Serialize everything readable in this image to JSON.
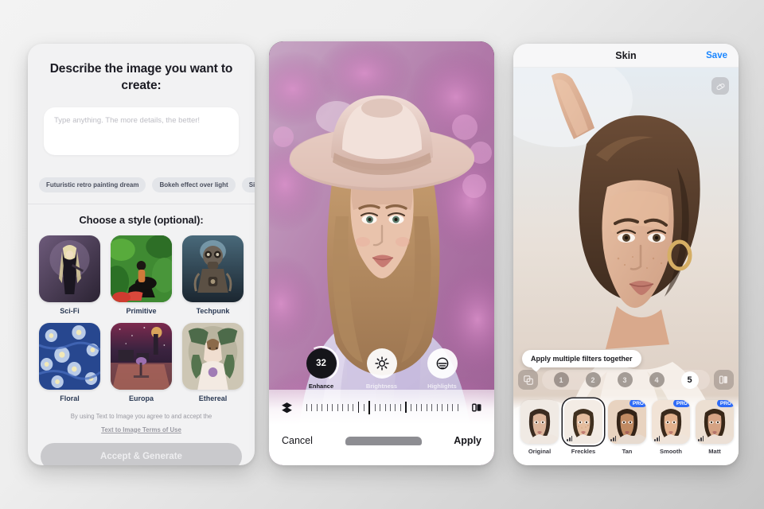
{
  "describe_panel": {
    "title": "Describe the image you want to create:",
    "prompt_input": {
      "value": "",
      "placeholder": "Type anything. The more details, the better!"
    },
    "suggestion_chips": [
      "Futuristic retro painting dream",
      "Bokeh effect over light",
      "Si"
    ],
    "style_section_title": "Choose a style (optional):",
    "styles": [
      {
        "label": "Sci-Fi"
      },
      {
        "label": "Primitive"
      },
      {
        "label": "Techpunk"
      },
      {
        "label": "Floral"
      },
      {
        "label": "Europa"
      },
      {
        "label": "Ethereal"
      }
    ],
    "terms_text": "By using Text to Image you agree to and accept the",
    "terms_link": "Text to Image Terms of Use",
    "cta_label": "Accept & Generate"
  },
  "editor_panel": {
    "tools": [
      {
        "label": "Enhance",
        "value": "32",
        "state": "active"
      },
      {
        "label": "Brightness",
        "value": "",
        "state": "inactive"
      },
      {
        "label": "Highlights",
        "value": "",
        "state": "inactive"
      }
    ],
    "layers_icon": "layers-icon",
    "compare_icon": "compare-icon",
    "cancel_label": "Cancel",
    "apply_label": "Apply"
  },
  "skin_panel": {
    "title": "Skin",
    "save_label": "Save",
    "eraser_icon": "eraser-icon",
    "tooltip": "Apply multiple filters together",
    "stack_icon": "stack-icon",
    "compare_icon": "compare-icon",
    "intensity_steps": [
      "1",
      "2",
      "3",
      "4",
      "5"
    ],
    "intensity_selected": "5",
    "filters": [
      {
        "label": "Original",
        "pro": false,
        "selected": false
      },
      {
        "label": "Freckles",
        "pro": false,
        "selected": true
      },
      {
        "label": "Tan",
        "pro": true,
        "selected": false
      },
      {
        "label": "Smooth",
        "pro": true,
        "selected": false
      },
      {
        "label": "Matt",
        "pro": true,
        "selected": false
      }
    ],
    "pro_badge_label": "PRO"
  },
  "colors": {
    "accent_blue": "#1a86ff",
    "pro_blue": "#2f6bf6",
    "dial_dark": "#15151a",
    "cta_disabled": "#c9c9cc"
  }
}
